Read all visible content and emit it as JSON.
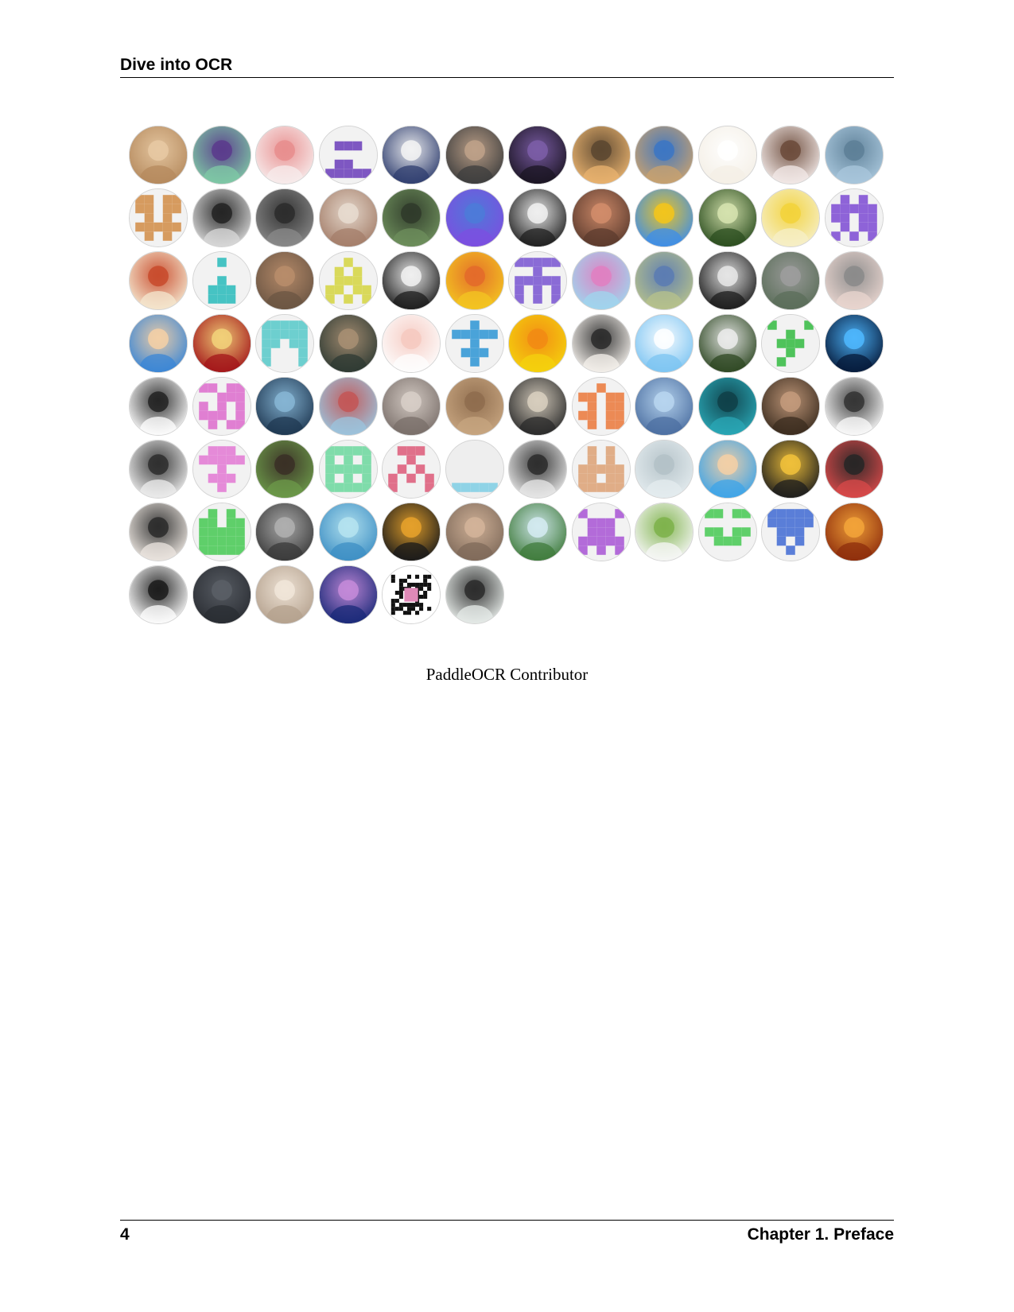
{
  "header": {
    "title": "Dive into OCR"
  },
  "figure": {
    "caption": "PaddleOCR Contributor",
    "columns": 12,
    "avatars": [
      {
        "icon": "pug-photo",
        "bg": "#b58a5e",
        "fg": "#e7c9a3"
      },
      {
        "icon": "cartoon-pair",
        "bg": "#7fc9a5",
        "fg": "#5a3a8c"
      },
      {
        "icon": "pig-cartoon",
        "bg": "#f7ecec",
        "fg": "#e88d8d"
      },
      {
        "icon": "identicon",
        "bg": "#f2f2f2",
        "fg": "#7e57c2",
        "pattern": "0000001110000000110011111"
      },
      {
        "icon": "donald-duck",
        "bg": "#2f3e6f",
        "fg": "#f5f5f5"
      },
      {
        "icon": "person-photo",
        "bg": "#3d3d3d",
        "fg": "#bfa28a"
      },
      {
        "icon": "night-tree",
        "bg": "#1b1523",
        "fg": "#7d5ea8"
      },
      {
        "icon": "sunset-landscape",
        "bg": "#e9b36f",
        "fg": "#5a4630"
      },
      {
        "icon": "plush-toys",
        "bg": "#c8a16f",
        "fg": "#3b76c4"
      },
      {
        "icon": "baymax",
        "bg": "#f4efe6",
        "fg": "#ffffff"
      },
      {
        "icon": "anime-girl",
        "bg": "#f3eae8",
        "fg": "#6b4a3a"
      },
      {
        "icon": "city-skyline",
        "bg": "#a9c7dc",
        "fg": "#5d7f97"
      },
      {
        "icon": "identicon",
        "bg": "#f2f2f2",
        "fg": "#d69b5f",
        "pattern": "1101111011010101111101010"
      },
      {
        "icon": "person-photo",
        "bg": "#d9d9d9",
        "fg": "#222222"
      },
      {
        "icon": "person-photo",
        "bg": "#8a8a8a",
        "fg": "#2b2b2b"
      },
      {
        "icon": "cat-photo",
        "bg": "#a47e6a",
        "fg": "#e8dcd0"
      },
      {
        "icon": "person-outdoor",
        "bg": "#6e8f5c",
        "fg": "#2f3a2a"
      },
      {
        "icon": "stitch-cartoon",
        "bg": "#7c4fe0",
        "fg": "#4c7bd8"
      },
      {
        "icon": "panda-photo",
        "bg": "#1f1f1f",
        "fg": "#f2f2f2"
      },
      {
        "icon": "anime-couple",
        "bg": "#5c3b2e",
        "fg": "#d28d6b"
      },
      {
        "icon": "sunflower",
        "bg": "#3e8ee8",
        "fg": "#f4c61a"
      },
      {
        "icon": "hydrangea",
        "bg": "#2b4d1f",
        "fg": "#d7e4b0"
      },
      {
        "icon": "psyduck",
        "bg": "#f6efc8",
        "fg": "#f2d23a"
      },
      {
        "icon": "identicon",
        "bg": "#f2f2f2",
        "fg": "#8e63d8",
        "pattern": "0101011111110110101110101"
      },
      {
        "icon": "luffy-cartoon",
        "bg": "#f4e7cf",
        "fg": "#c84a2b"
      },
      {
        "icon": "identicon",
        "bg": "#f2f2f2",
        "fg": "#46c3c3",
        "pattern": "0010000000001000111001110"
      },
      {
        "icon": "fantasy-art",
        "bg": "#6b5543",
        "fg": "#b98d6b"
      },
      {
        "icon": "identicon",
        "bg": "#f2f2f2",
        "fg": "#d9d95a",
        "pattern": "0010001010011101101110101"
      },
      {
        "icon": "running-silhouette",
        "bg": "#1c1c1c",
        "fg": "#f2f2f2"
      },
      {
        "icon": "cartoon-face",
        "bg": "#f3c521",
        "fg": "#e36a2a"
      },
      {
        "icon": "identicon",
        "bg": "#f2f2f2",
        "fg": "#8a6bd6",
        "pattern": "1111100100111111010110101"
      },
      {
        "icon": "candy-land",
        "bg": "#9fd5ee",
        "fg": "#e07fc1"
      },
      {
        "icon": "bird-photo",
        "bg": "#b7c28b",
        "fg": "#5b7bb3"
      },
      {
        "icon": "black-cat",
        "bg": "#1c1c1c",
        "fg": "#e8e8e8"
      },
      {
        "icon": "road-photo",
        "bg": "#5b6e59",
        "fg": "#9d9d9d"
      },
      {
        "icon": "girl-cap",
        "bg": "#e9d5cf",
        "fg": "#8a8a8a"
      },
      {
        "icon": "glasses-cartoon",
        "bg": "#3a86d6",
        "fg": "#f4d0a6"
      },
      {
        "icon": "iron-man-logo",
        "bg": "#a3161a",
        "fg": "#f2d27a"
      },
      {
        "icon": "identicon",
        "bg": "#f2f2f2",
        "fg": "#6dcfcf",
        "pattern": "1111111111110111000110001"
      },
      {
        "icon": "person-screen",
        "bg": "#2e3a33",
        "fg": "#a88f73"
      },
      {
        "icon": "pig-face",
        "bg": "#fdfdfd",
        "fg": "#f6c9c0"
      },
      {
        "icon": "identicon",
        "bg": "#f2f2f2",
        "fg": "#4aa3d9",
        "pattern": "0010011111001000111000100"
      },
      {
        "icon": "yellow-flower-pixel",
        "bg": "#f4d10d",
        "fg": "#f28a14"
      },
      {
        "icon": "panda-cartoon",
        "bg": "#f5f1ec",
        "fg": "#2a2a2a"
      },
      {
        "icon": "binary-cloud",
        "bg": "#7cc4f2",
        "fg": "#ffffff"
      },
      {
        "icon": "panda-photo",
        "bg": "#2d4722",
        "fg": "#ececec"
      },
      {
        "icon": "identicon",
        "bg": "#f2f2f2",
        "fg": "#4fc35b",
        "pattern": "1000100100011100010001000"
      },
      {
        "icon": "galaxy",
        "bg": "#061a3a",
        "fg": "#4fb8ff"
      },
      {
        "icon": "pig-outline-cartoon",
        "bg": "#ffffff",
        "fg": "#222222"
      },
      {
        "icon": "identicon",
        "bg": "#f2f2f2",
        "fg": "#e07fd2",
        "pattern": "1101100111101011110101011"
      },
      {
        "icon": "pyramid-art",
        "bg": "#1f3852",
        "fg": "#87b6d5"
      },
      {
        "icon": "festival-scene",
        "bg": "#9bc4dd",
        "fg": "#c35656"
      },
      {
        "icon": "cat-photo",
        "bg": "#7a6f6a",
        "fg": "#d8cfc8"
      },
      {
        "icon": "cat-photo",
        "bg": "#c7a580",
        "fg": "#8e6c4d"
      },
      {
        "icon": "guitarist-photo",
        "bg": "#2a2a2a",
        "fg": "#d9d0c0"
      },
      {
        "icon": "identicon",
        "bg": "#f2f2f2",
        "fg": "#ec8a55",
        "pattern": "0010011011010111101101011"
      },
      {
        "icon": "anime-figure",
        "bg": "#4c6fa1",
        "fg": "#b9d6f0"
      },
      {
        "icon": "monster-plush",
        "bg": "#2aa7b5",
        "fg": "#0f3f48"
      },
      {
        "icon": "person-bar",
        "bg": "#3b2c1f",
        "fg": "#c49b7c"
      },
      {
        "icon": "comic-sketch",
        "bg": "#fbfbfb",
        "fg": "#333333"
      },
      {
        "icon": "person-glasses",
        "bg": "#eeeeee",
        "fg": "#2d2d2d"
      },
      {
        "icon": "identicon",
        "bg": "#f2f2f2",
        "fg": "#e58ad8",
        "pattern": "0111011111001000111000100"
      },
      {
        "icon": "person-field",
        "bg": "#6c9a4a",
        "fg": "#3a2f26"
      },
      {
        "icon": "identicon",
        "bg": "#f2f2f2",
        "fg": "#7fdcaa",
        "pattern": "1111110101111111010111111"
      },
      {
        "icon": "identicon",
        "bg": "#f2f2f2",
        "fg": "#e0708a",
        "pattern": "0111000100010101010110001"
      },
      {
        "icon": "identicon",
        "bg": "#eeeeee",
        "fg": "#8fd3e6",
        "pattern": "0000000000000000000011111"
      },
      {
        "icon": "person-suit",
        "bg": "#e8e8e8",
        "fg": "#2b2b2b"
      },
      {
        "icon": "identicon",
        "bg": "#f2f2f2",
        "fg": "#e0ad87",
        "pattern": "0101001010111111101111111"
      },
      {
        "icon": "snow-texture",
        "bg": "#e4ecef",
        "fg": "#b3c1c7"
      },
      {
        "icon": "glasses-cartoon",
        "bg": "#3ea4e8",
        "fg": "#f4d0a6"
      },
      {
        "icon": "basketball-player",
        "bg": "#1d1d1d",
        "fg": "#f2c23b"
      },
      {
        "icon": "black-cat-cartoon",
        "bg": "#d94a4a",
        "fg": "#262626"
      },
      {
        "icon": "husky-puppy",
        "bg": "#ece6e0",
        "fg": "#2a2a2a"
      },
      {
        "icon": "identicon",
        "bg": "#f2f2f2",
        "fg": "#5fcf6a",
        "pattern": "0101011011111111111111111"
      },
      {
        "icon": "keyboard-photo",
        "bg": "#3a3a3a",
        "fg": "#b0b0b0"
      },
      {
        "icon": "fairy-cartoon",
        "bg": "#3e8fc4",
        "fg": "#b6e4f0"
      },
      {
        "icon": "straw-hat-cartoon",
        "bg": "#1a1a1a",
        "fg": "#e7a22b"
      },
      {
        "icon": "person-selfie",
        "bg": "#7f6a5a",
        "fg": "#d3b49a"
      },
      {
        "icon": "waterfall",
        "bg": "#3f7b3b",
        "fg": "#d5ebf2"
      },
      {
        "icon": "identicon",
        "bg": "#f2f2f2",
        "fg": "#b36bd9",
        "pattern": "1000101110011101111110101"
      },
      {
        "icon": "coding-cartoon",
        "bg": "#f7f7f7",
        "fg": "#7db24a"
      },
      {
        "icon": "identicon",
        "bg": "#f2f2f2",
        "fg": "#5fcf6a",
        "pattern": "1101100000110110111000000"
      },
      {
        "icon": "identicon",
        "bg": "#f2f2f2",
        "fg": "#5a7ed8",
        "pattern": "1111111111011100101000100"
      },
      {
        "icon": "fire",
        "bg": "#8e2d0c",
        "fg": "#f3a43a"
      },
      {
        "icon": "panda-cartoon",
        "bg": "#ffffff",
        "fg": "#1a1a1a"
      },
      {
        "icon": "black-dog",
        "bg": "#2a2d33",
        "fg": "#5a5f66"
      },
      {
        "icon": "unicorn-art",
        "bg": "#b4a18e",
        "fg": "#f1e6d9"
      },
      {
        "icon": "space-nebula",
        "bg": "#1a2a78",
        "fg": "#c58bd9"
      },
      {
        "icon": "qr-code",
        "bg": "#ffffff",
        "fg": "#111111"
      },
      {
        "icon": "person-outdoor",
        "bg": "#e7ece9",
        "fg": "#2a2a2a"
      }
    ]
  },
  "footer": {
    "page_number": "4",
    "chapter": "Chapter 1.  Preface"
  }
}
